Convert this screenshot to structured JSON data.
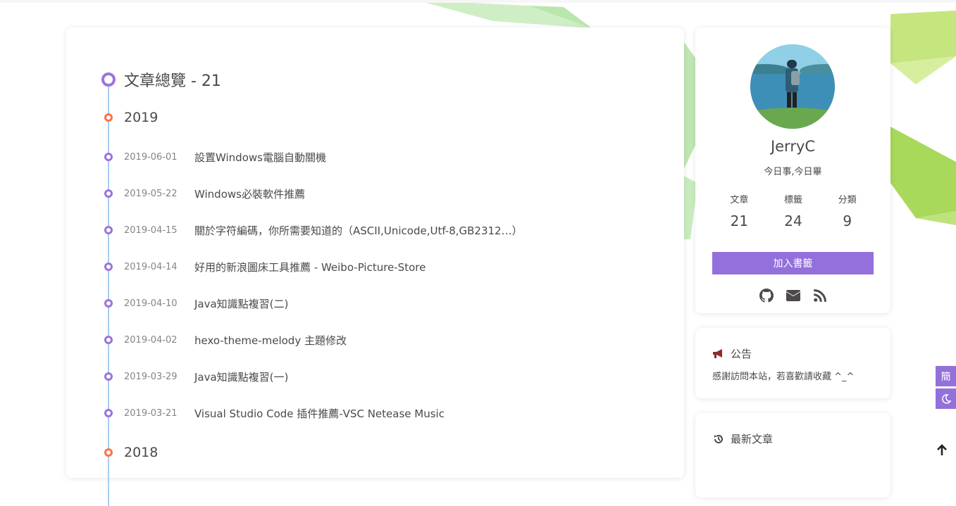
{
  "archive": {
    "title": "文章總覽 - 21",
    "years": [
      {
        "year": "2019",
        "posts": [
          {
            "date": "2019-06-01",
            "title": "設置Windows電腦自動關機"
          },
          {
            "date": "2019-05-22",
            "title": "Windows必裝軟件推薦"
          },
          {
            "date": "2019-04-15",
            "title": "關於字符編碼，你所需要知道的（ASCII,Unicode,Utf-8,GB2312…）"
          },
          {
            "date": "2019-04-14",
            "title": "好用的新浪圖床工具推薦 - Weibo-Picture-Store"
          },
          {
            "date": "2019-04-10",
            "title": "Java知識點複習(二)"
          },
          {
            "date": "2019-04-02",
            "title": "hexo-theme-melody 主題修改"
          },
          {
            "date": "2019-03-29",
            "title": "Java知識點複習(一)"
          },
          {
            "date": "2019-03-21",
            "title": "Visual Studio Code 插件推薦-VSC Netease Music"
          }
        ]
      },
      {
        "year": "2018",
        "posts": []
      }
    ]
  },
  "author": {
    "name": "JerryC",
    "description": "今日事,今日畢",
    "stats": [
      {
        "label": "文章",
        "value": "21"
      },
      {
        "label": "標籤",
        "value": "24"
      },
      {
        "label": "分類",
        "value": "9"
      }
    ],
    "bookmark_label": "加入書籤",
    "social_icons": [
      "github-icon",
      "email-icon",
      "rss-icon"
    ]
  },
  "announcement": {
    "title": "公告",
    "text": "感謝訪問本站，若喜歡請收藏 ^_^"
  },
  "recent": {
    "title": "最新文章"
  },
  "floating": {
    "simplified_label": "簡"
  },
  "colors": {
    "accent": "#9370db",
    "year_dot": "#ff7242",
    "timeline": "#a6cdf5"
  }
}
